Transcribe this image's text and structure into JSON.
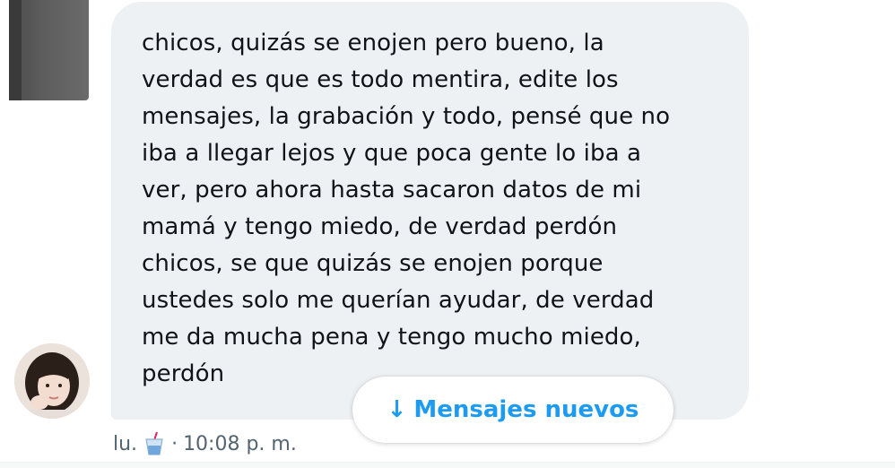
{
  "message": {
    "text": "chicos, quizás se enojen pero bueno, la\nverdad es que es todo mentira, edite los\nmensajes, la grabación y todo, pensé que no\niba a llegar lejos y que poca gente lo iba a\nver, pero ahora hasta sacaron datos de mi\nmamá y tengo miedo, de verdad perdón\nchicos, se que quizás se enojen porque\nustedes solo me querían ayudar, de verdad\nme da mucha pena y tengo mucho miedo,\nperdón",
    "sender_initial": "lu.",
    "separator": "·",
    "time": "10:08 p. m.",
    "reaction_icon": "cup-drink-icon"
  },
  "new_messages_button": {
    "arrow": "↓",
    "label": "Mensajes nuevos",
    "color": "#1d9bf0"
  },
  "colors": {
    "bubble_bg": "#eef1f4",
    "text": "#0f1419",
    "meta": "#536471"
  }
}
